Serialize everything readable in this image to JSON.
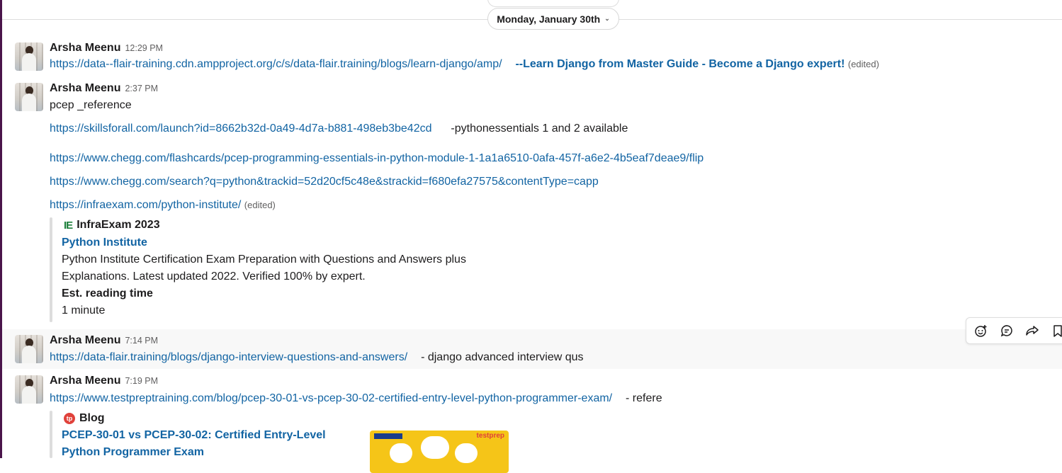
{
  "date_divider": {
    "label": "Monday, January 30th"
  },
  "messages": [
    {
      "author": "Arsha Meenu",
      "time": "12:29 PM",
      "link": "https://data--flair-training.cdn.ampproject.org/c/s/data-flair.training/blogs/learn-django/amp/",
      "bold_link": "--Learn Django from Master Guide - Become a Django expert!",
      "edited": "(edited)"
    },
    {
      "author": "Arsha Meenu",
      "time": "2:37 PM",
      "text": "pcep _reference",
      "link1": "https://skillsforall.com/launch?id=8662b32d-0a49-4d7a-b881-498eb3be42cd",
      "link1_note": "-pythonessentials 1 and 2 available",
      "link2": "https://www.chegg.com/flashcards/pcep-programming-essentials-in-python-module-1-1a1a6510-0afa-457f-a6e2-4b5eaf7deae9/flip",
      "link3": "https://www.chegg.com/search?q=python&trackid=52d20cf5c48e&strackid=f680efa27575&contentType=capp",
      "link4": "https://infraexam.com/python-institute/",
      "edited": "(edited)",
      "attachment": {
        "icon_text": "IE",
        "source": "InfraExam 2023",
        "title": "Python Institute",
        "desc_line1": "Python Institute Certification Exam Preparation with Questions and Answers plus",
        "desc_line2": "Explanations. Latest updated 2022. Verified 100% by expert.",
        "field_label": "Est. reading time",
        "field_value": "1 minute"
      }
    },
    {
      "author": "Arsha Meenu",
      "time": "7:14 PM",
      "link": "https://data-flair.training/blogs/django-interview-questions-and-answers/",
      "note": "- django advanced interview qus"
    },
    {
      "author": "Arsha Meenu",
      "time": "7:19 PM",
      "link": "https://www.testpreptraining.com/blog/pcep-30-01-vs-pcep-30-02-certified-entry-level-python-programmer-exam/",
      "note": "- refere",
      "attachment": {
        "icon_text": "tp",
        "source": "Blog",
        "title_line1": "PCEP-30-01 vs PCEP-30-02: Certified Entry-Level",
        "title_line2": "Python Programmer Exam",
        "thumb_text": "testprep"
      }
    }
  ],
  "toolbar": [
    "add-reaction-icon",
    "reply-in-thread-icon",
    "share-message-icon",
    "save-for-later-icon"
  ]
}
